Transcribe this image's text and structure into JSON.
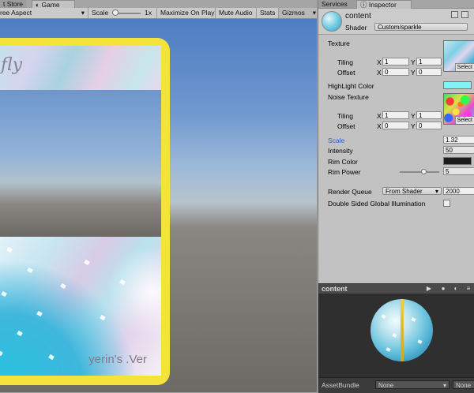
{
  "game": {
    "tabs": [
      {
        "label": "t Store",
        "active": false
      },
      {
        "label": "Game",
        "active": true
      }
    ],
    "toolbar": {
      "aspect": "ree Aspect",
      "scale_label": "Scale",
      "scale_value": "1x",
      "maximize": "Maximize On Play",
      "mute": "Mute Audio",
      "stats": "Stats",
      "gizmos": "Gizmos"
    },
    "card": {
      "title": "fly",
      "signature": "yerin's .Ver"
    }
  },
  "inspector": {
    "tabs": [
      {
        "label": "Services",
        "active": false
      },
      {
        "label": "Inspector",
        "active": true
      }
    ],
    "material": {
      "name": "content",
      "shader_label": "Shader",
      "shader_value": "Custom/sparkle"
    },
    "texture": {
      "label": "Texture",
      "tiling_label": "Tiling",
      "offset_label": "Offset",
      "tiling_x": "1",
      "tiling_y": "1",
      "offset_x": "0",
      "offset_y": "0",
      "select": "Select"
    },
    "highlight": {
      "label": "HighLight Color",
      "color": "#7ff3f5"
    },
    "noise": {
      "label": "Noise Texture",
      "tiling_label": "Tiling",
      "offset_label": "Offset",
      "tiling_x": "1",
      "tiling_y": "1",
      "offset_x": "0",
      "offset_y": "0",
      "select": "Select"
    },
    "scale": {
      "label": "Scale",
      "value": "1.32",
      "label_color": "#2f5fc0"
    },
    "intensity": {
      "label": "Intensity",
      "value": "50"
    },
    "rim_color": {
      "label": "Rim Color",
      "color": "#1c1c1c"
    },
    "rim_power": {
      "label": "Rim Power",
      "value": "5"
    },
    "render_queue": {
      "label": "Render Queue",
      "mode": "From Shader",
      "value": "2000"
    },
    "double_sided": {
      "label": "Double Sided Global Illumination",
      "checked": false
    },
    "preview": {
      "title": "content"
    },
    "asset_bundle": {
      "label": "AssetBundle",
      "bundle": "None",
      "variant": "None"
    },
    "axis": {
      "x": "X",
      "y": "Y"
    }
  }
}
